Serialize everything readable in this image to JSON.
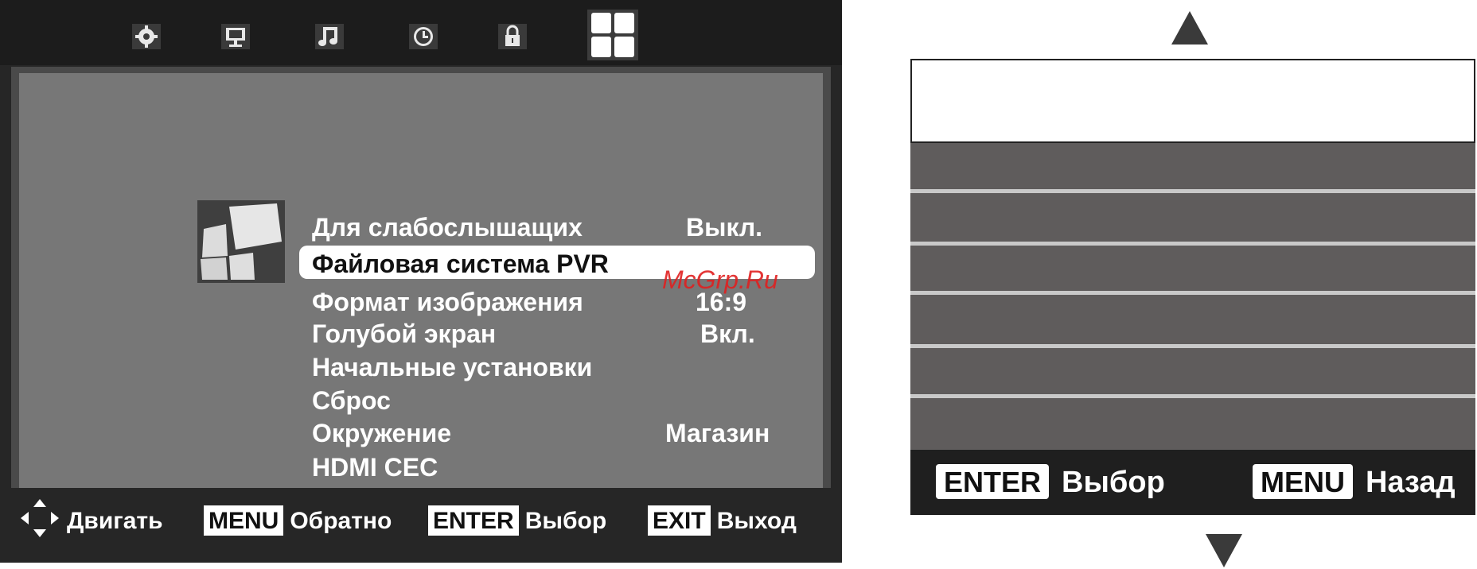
{
  "tv_menu": {
    "tabs": [
      {
        "icon": "gear-icon"
      },
      {
        "icon": "monitor-icon"
      },
      {
        "icon": "music-note-icon"
      },
      {
        "icon": "clock-icon"
      },
      {
        "icon": "lock-icon"
      },
      {
        "icon": "grid-icon",
        "active": true
      }
    ],
    "items": [
      {
        "label": "Для слабослышащих",
        "value": "Выкл."
      },
      {
        "label": "Файловая система PVR",
        "value": ""
      },
      {
        "label": "Формат изображения",
        "value": "16:9"
      },
      {
        "label": "Голубой экран",
        "value": "Вкл."
      },
      {
        "label": "Начальные установки",
        "value": ""
      },
      {
        "label": "Сброс",
        "value": ""
      },
      {
        "label": "Окружение",
        "value": "Магазин"
      },
      {
        "label": "HDMI CEC",
        "value": ""
      }
    ],
    "selected_index": 1,
    "footer": {
      "move_label": "Двигать",
      "menu_key": "MENU",
      "menu_label": "Обратно",
      "enter_key": "ENTER",
      "enter_label": "Выбор",
      "exit_key": "EXIT",
      "exit_label": "Выход"
    },
    "watermark": "McGrp.Ru"
  },
  "dialog": {
    "title": "",
    "rows": [
      "",
      "",
      "",
      "",
      "",
      ""
    ],
    "footer": {
      "enter_key": "ENTER",
      "enter_label": "Выбор",
      "menu_key": "MENU",
      "menu_label": "Назад"
    }
  },
  "colors": {
    "panel": "#777777",
    "selection": "#ffffff",
    "dialog_rows": "#5f5c5c",
    "footer_bg": "#1f1f1f"
  }
}
